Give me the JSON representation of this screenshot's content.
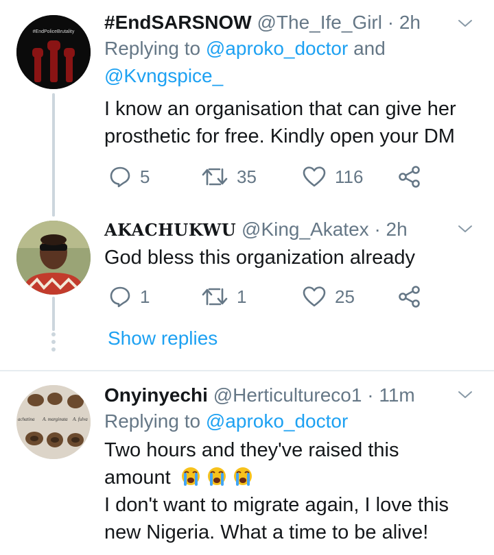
{
  "tweets": [
    {
      "name": "#EndSARSNOW",
      "handle": "@The_Ife_Girl",
      "time": "· 2h",
      "replying_label": "Replying to",
      "replying_mention1": "@aproko_doctor",
      "replying_and": "and",
      "replying_mention2": "@Kvngspice_",
      "text_line1": "I know an organisation that can give her",
      "text_line2": "prosthetic for free. Kindly open your DM",
      "avatar_text": "#EndPoliceBrutality",
      "replies": "5",
      "retweets": "35",
      "likes": "116"
    },
    {
      "name": "AKACHUKWU",
      "handle": "@King_Akatex",
      "time": "· 2h",
      "text_line1": "God bless this organization already",
      "replies": "1",
      "retweets": "1",
      "likes": "25"
    },
    {
      "name": "Onyinyechi",
      "handle": "@Herticultureco1",
      "time": "· 11m",
      "replying_label": "Replying to",
      "replying_mention1": "@aproko_doctor",
      "text_line1": "Two hours and they've raised this",
      "text_line2": "amount",
      "text_line3": "I don't want to migrate again, I love this",
      "text_line4": "new Nigeria. What a time to be alive!",
      "avatar_labels": [
        "achatina",
        "A. marginata",
        "A. fulva"
      ]
    }
  ],
  "show_replies": "Show replies",
  "icons": {
    "reply": "reply-icon",
    "retweet": "retweet-icon",
    "like": "heart-icon",
    "share": "share-icon",
    "more": "chevron-down-icon",
    "emoji": "crying-face-emoji"
  },
  "colors": {
    "link": "#1da1f2",
    "secondary": "#657786",
    "text": "#14171a",
    "thread_line": "#ccd6dd"
  }
}
